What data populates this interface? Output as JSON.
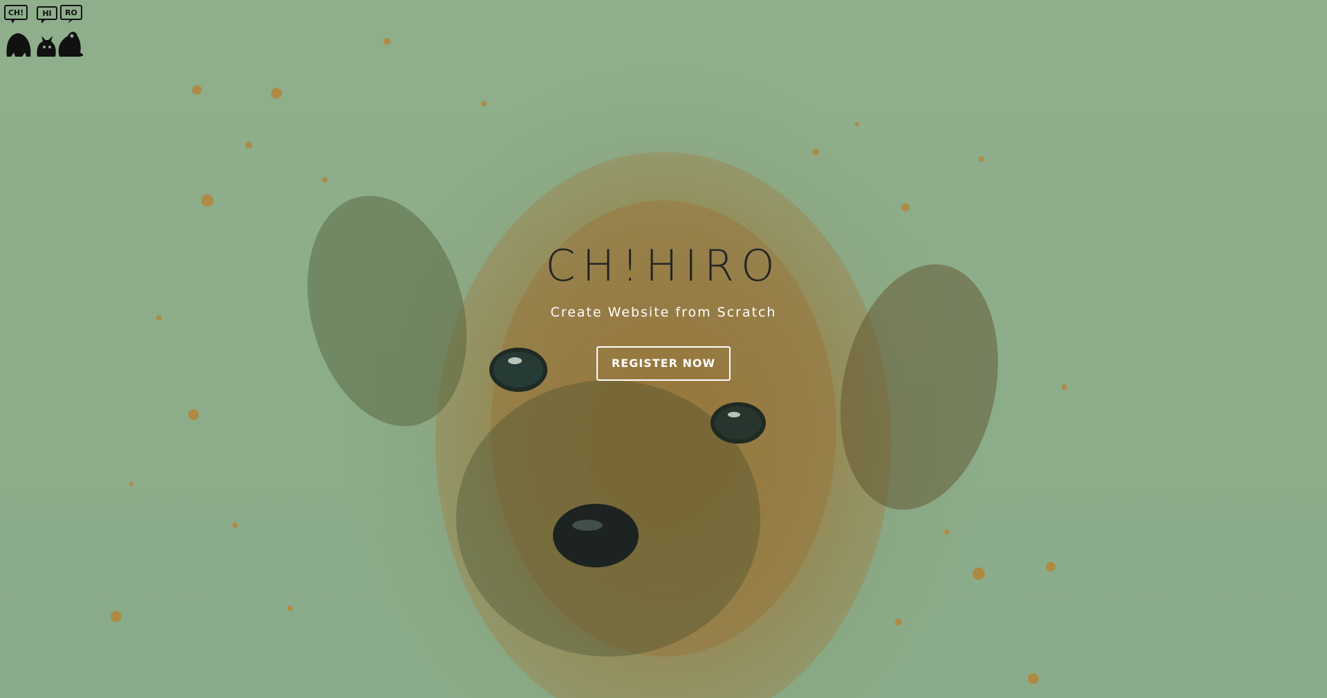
{
  "logo": {
    "bubbles": [
      "CH!",
      "HI",
      "RO"
    ],
    "icon": "chihiro-monsters-logo"
  },
  "hero": {
    "title": "CH!HIRO",
    "subtitle": "Create Website from Scratch",
    "cta_label": "REGISTER NOW",
    "background_icon": "puppy-watercolor-illustration"
  },
  "colors": {
    "background": "#8fae8c",
    "title": "#232425",
    "subtitle": "#ffffff",
    "button_border": "#ffffff",
    "splash": "#b8802f"
  }
}
